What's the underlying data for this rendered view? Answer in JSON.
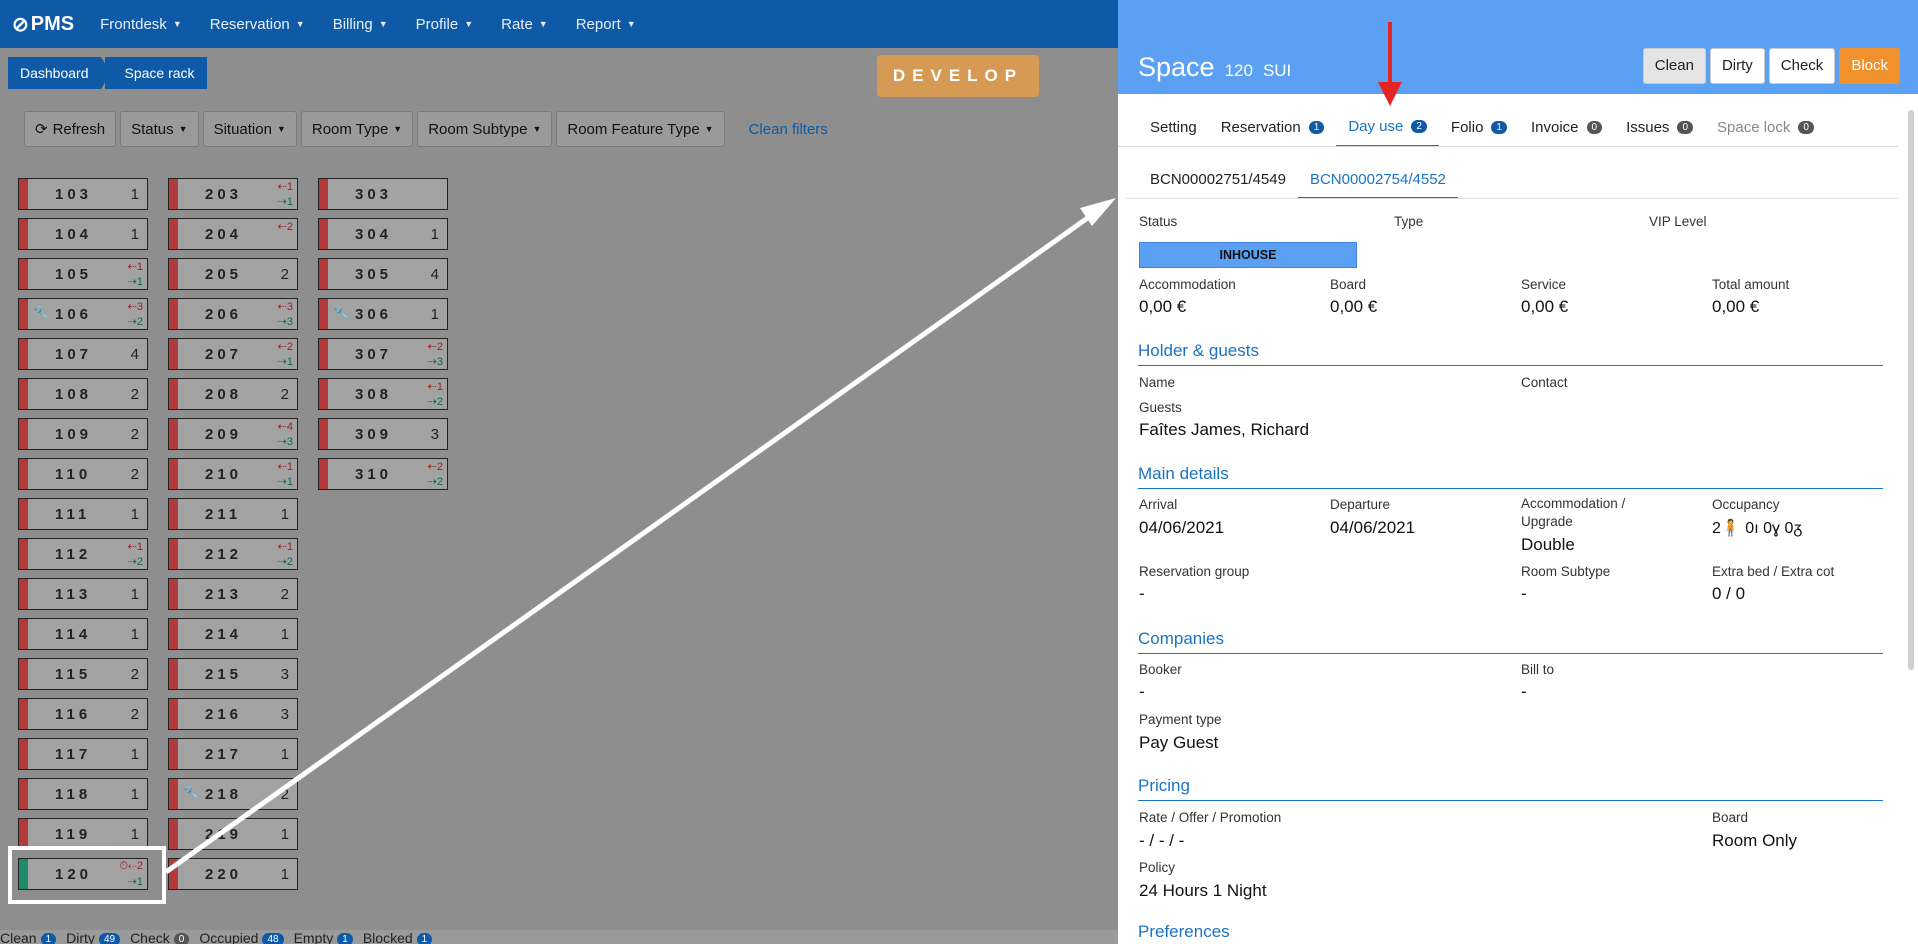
{
  "app": {
    "logo": "PMS"
  },
  "nav": [
    {
      "label": "Frontdesk"
    },
    {
      "label": "Reservation"
    },
    {
      "label": "Billing"
    },
    {
      "label": "Profile"
    },
    {
      "label": "Rate"
    },
    {
      "label": "Report"
    }
  ],
  "breadcrumb": {
    "first": "Dashboard",
    "second": "Space rack"
  },
  "env_badge": "DEVELOP",
  "filters": {
    "refresh": "Refresh",
    "status": "Status",
    "situation": "Situation",
    "room_type": "Room Type",
    "room_subtype": "Room Subtype",
    "room_feature_type": "Room Feature Type",
    "clean": "Clean filters"
  },
  "rooms": [
    {
      "num": "103",
      "cnt": "1"
    },
    {
      "num": "104",
      "cnt": "1"
    },
    {
      "num": "105",
      "b1": "1",
      "b2": "1"
    },
    {
      "num": "106",
      "b1": "3",
      "b2": "2",
      "wrench": true
    },
    {
      "num": "107",
      "cnt": "4"
    },
    {
      "num": "108",
      "cnt": "2"
    },
    {
      "num": "109",
      "cnt": "2"
    },
    {
      "num": "110",
      "cnt": "2"
    },
    {
      "num": "111",
      "cnt": "1"
    },
    {
      "num": "112",
      "b1": "1",
      "b2": "2"
    },
    {
      "num": "113",
      "cnt": "1"
    },
    {
      "num": "114",
      "cnt": "1"
    },
    {
      "num": "115",
      "cnt": "2"
    },
    {
      "num": "116",
      "cnt": "2"
    },
    {
      "num": "117",
      "cnt": "1"
    },
    {
      "num": "118",
      "cnt": "1"
    },
    {
      "num": "119",
      "cnt": "1"
    },
    {
      "num": "120",
      "b1": "2",
      "b2": "1",
      "clean": true
    },
    {
      "num": "203",
      "b1": "1",
      "b2": "1"
    },
    {
      "num": "204",
      "b1": "2"
    },
    {
      "num": "205",
      "cnt": "2"
    },
    {
      "num": "206",
      "b1": "3",
      "b2": "3"
    },
    {
      "num": "207",
      "b1": "2",
      "b2": "1"
    },
    {
      "num": "208",
      "cnt": "2"
    },
    {
      "num": "209",
      "b1": "4",
      "b2": "3"
    },
    {
      "num": "210",
      "b1": "1",
      "b2": "1"
    },
    {
      "num": "211",
      "cnt": "1"
    },
    {
      "num": "212",
      "b1": "1",
      "b2": "2"
    },
    {
      "num": "213",
      "cnt": "2"
    },
    {
      "num": "214",
      "cnt": "1"
    },
    {
      "num": "215",
      "cnt": "3"
    },
    {
      "num": "216",
      "cnt": "3"
    },
    {
      "num": "217",
      "cnt": "1"
    },
    {
      "num": "218",
      "cnt": "2",
      "wrench": true
    },
    {
      "num": "219",
      "cnt": "1"
    },
    {
      "num": "220",
      "cnt": "1"
    },
    {
      "num": "303"
    },
    {
      "num": "304",
      "cnt": "1"
    },
    {
      "num": "305",
      "cnt": "4"
    },
    {
      "num": "306",
      "cnt": "1",
      "wrench": true
    },
    {
      "num": "307",
      "b1": "2",
      "b2": "3"
    },
    {
      "num": "308",
      "b1": "1",
      "b2": "2"
    },
    {
      "num": "309",
      "cnt": "3"
    },
    {
      "num": "310",
      "b1": "2",
      "b2": "2"
    }
  ],
  "status_bar": {
    "clean": "Clean",
    "clean_n": "1",
    "dirty": "Dirty",
    "dirty_n": "49",
    "check": "Check",
    "check_n": "0",
    "occupied": "Occupied",
    "occupied_n": "48",
    "empty": "Empty",
    "empty_n": "1",
    "blocked": "Blocked",
    "blocked_n": "1"
  },
  "panel": {
    "title": "Space",
    "room": "120",
    "type": "SUI",
    "buttons": {
      "clean": "Clean",
      "dirty": "Dirty",
      "check": "Check",
      "block": "Block"
    },
    "tabs": [
      {
        "label": "Setting"
      },
      {
        "label": "Reservation",
        "count": "1"
      },
      {
        "label": "Day use",
        "count": "2"
      },
      {
        "label": "Folio",
        "count": "1"
      },
      {
        "label": "Invoice",
        "count": "0"
      },
      {
        "label": "Issues",
        "count": "0"
      },
      {
        "label": "Space lock",
        "count": "0"
      }
    ],
    "subtabs": [
      "BCN00002751/4549",
      "BCN00002754/4552"
    ],
    "status_label": "Status",
    "type_label": "Type",
    "vip_label": "VIP Level",
    "status_value": "INHOUSE",
    "amounts": {
      "acc_l": "Accommodation",
      "acc": "0,00 €",
      "board_l": "Board",
      "board": "0,00 €",
      "service_l": "Service",
      "service": "0,00 €",
      "total_l": "Total amount",
      "total": "0,00 €"
    },
    "holder_title": "Holder & guests",
    "name_l": "Name",
    "contact_l": "Contact",
    "guests_l": "Guests",
    "guests": "Faîtes James, Richard",
    "main_title": "Main details",
    "arrival_l": "Arrival",
    "arrival": "04/06/2021",
    "departure_l": "Departure",
    "departure": "04/06/2021",
    "acc_up_l1": "Accommodation /",
    "acc_up_l2": "Upgrade",
    "acc_up": "Double",
    "occupancy_l": "Occupancy",
    "occupancy": {
      "adults": "2",
      "teens": "0",
      "children": "0",
      "infants": "0"
    },
    "res_group_l": "Reservation group",
    "res_group": "-",
    "subtype_l": "Room Subtype",
    "subtype": "-",
    "extra_l": "Extra bed / Extra cot",
    "extra": "0 / 0",
    "companies_title": "Companies",
    "booker_l": "Booker",
    "booker": "-",
    "billto_l": "Bill to",
    "billto": "-",
    "payment_l": "Payment type",
    "payment": "Pay Guest",
    "pricing_title": "Pricing",
    "rate_l": "Rate / Offer / Promotion",
    "rate": "- / - / -",
    "board_l2": "Board",
    "board_val": "Room Only",
    "policy_l": "Policy",
    "policy": "24 Hours 1 Night",
    "preferences_title": "Preferences"
  }
}
